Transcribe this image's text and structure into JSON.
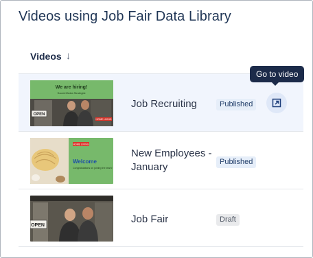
{
  "panel": {
    "heading": "Videos using Job Fair Data Library"
  },
  "table": {
    "column_header": "Videos",
    "sort_icon": "arrow-down-icon",
    "rows": [
      {
        "title": "Job Recruiting",
        "status": "Published",
        "thumbnail": {
          "banner_title": "We are hiring!",
          "banner_subtitle": "Social Media Strategist",
          "sign": "OPEN",
          "tag": "HOME LIVING"
        }
      },
      {
        "title": "New Employees - January",
        "status": "Published",
        "thumbnail": {
          "tag": "HOME LIVING",
          "heading": "Welcome",
          "body": "Congratulations on joining the team!"
        }
      },
      {
        "title": "Job Fair",
        "status": "Draft",
        "thumbnail": {
          "sign": "OPEN"
        }
      }
    ]
  },
  "go_to_video": {
    "tooltip": "Go to video",
    "icon": "external-link-icon"
  },
  "colors": {
    "heading": "#1f3555",
    "thumbnail_green": "#77b96b",
    "hover_row": "#f1f5fd",
    "tooltip_bg": "#1c2b4a",
    "badge_published_bg": "#e6eef9",
    "badge_draft_bg": "#e9eaec"
  }
}
